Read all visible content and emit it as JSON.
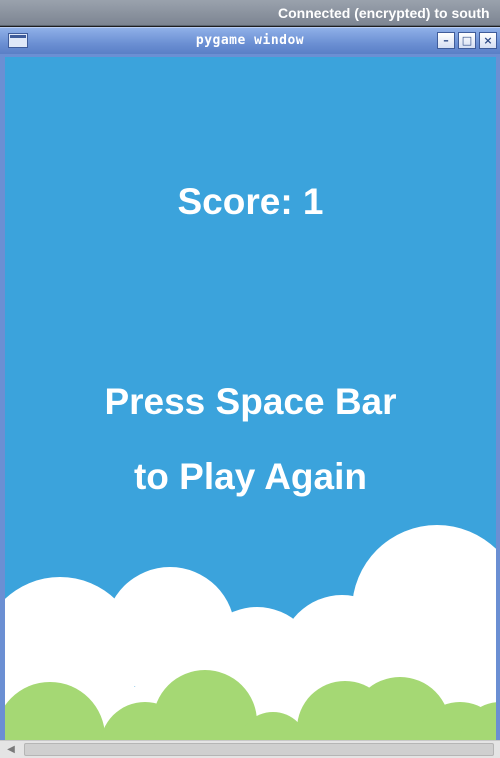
{
  "vnc": {
    "status_text": "Connected (encrypted) to south"
  },
  "window": {
    "title": "pygame window",
    "icons": {
      "app": "window-icon",
      "minimize": "minimize-icon",
      "maximize": "maximize-icon",
      "close": "close-icon"
    },
    "minimize_glyph": "–",
    "maximize_glyph": "□",
    "close_glyph": "×"
  },
  "game": {
    "score_text": "Score: 1",
    "message_line1": "Press Space Bar",
    "message_line2": "to Play Again",
    "colors": {
      "sky": "#3ba3dc",
      "clouds": "#ffffff",
      "bushes": "#a5d874",
      "text": "#ffffff"
    }
  },
  "scrollbar": {
    "left_arrow_glyph": "◀"
  }
}
